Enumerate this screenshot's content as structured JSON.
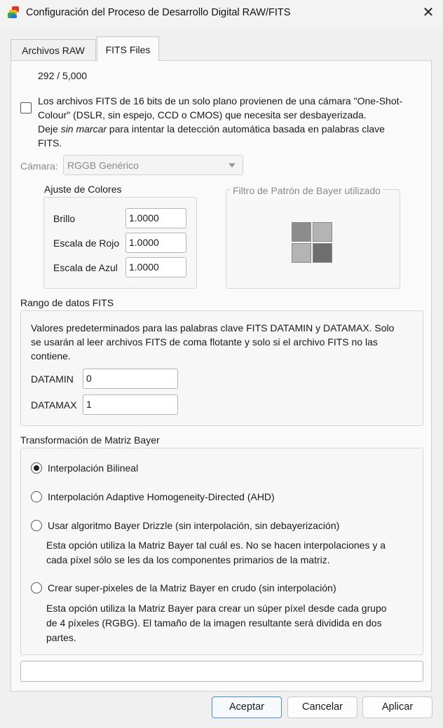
{
  "window": {
    "title": "Configuración del Proceso de Desarrollo Digital RAW/FITS",
    "close_glyph": "✕",
    "app_icon": "color-layers-icon"
  },
  "tabs": [
    {
      "label": "Archivos RAW",
      "active": false
    },
    {
      "label": "FITS Files",
      "active": true
    }
  ],
  "fits": {
    "counter": "292 / 5,000",
    "osc_checkbox_checked": false,
    "osc_desc_lines": [
      "Los archivos FITS de 16 bits de un solo plano provienen de una cámara \"One-Shot-",
      "Colour\" (DSLR, sin espejo, CCD o CMOS) que necesita ser desbayerizada."
    ],
    "hint_prefix": "Deje ",
    "hint_em": "sin marcar",
    "hint_suffix": " para intentar la detección automática basada en palabras clave",
    "hint_line2": "FITS.",
    "camera_label": "Cámara:",
    "camera_value": "RGGB Genérico",
    "color_group_title": "Ajuste de Colores",
    "brightness_label": "Brillo",
    "brightness_value": "1.0000",
    "red_label": "Escala de Rojo",
    "red_value": "1.0000",
    "blue_label": "Escala de Azul",
    "blue_value": "1.0000",
    "bayer_group_title": "Filtro de Patrón de Bayer utilizado",
    "bayer_colors": [
      "#8c8c8c",
      "#b4b4b4",
      "#b4b4b4",
      "#6e6e6e"
    ],
    "range_title": "Rango de datos FITS",
    "range_desc_lines": [
      "Valores predeterminados para las palabras clave FITS DATAMIN y DATAMAX. Solo",
      "se usarán al leer archivos FITS de coma flotante y solo si el archivo FITS no las",
      "contiene."
    ],
    "datamin_label": "DATAMIN",
    "datamin_value": "0",
    "datamax_label": "DATAMAX",
    "datamax_value": "1",
    "matrix_title": "Transformación de Matriz Bayer",
    "options": [
      {
        "label": "Interpolación Bilineal",
        "checked": true,
        "desc": []
      },
      {
        "label": "Interpolación Adaptive Homogeneity-Directed (AHD)",
        "checked": false,
        "desc": []
      },
      {
        "label": "Usar algoritmo Bayer Drizzle (sin interpolación, sin debayerización)",
        "checked": false,
        "desc": [
          "Esta opción utiliza la Matriz Bayer tal cuál es. No se hacen interpolaciones y a",
          "cada píxel sólo se les da los componentes primarios de la matriz."
        ]
      },
      {
        "label": "Crear super-pixeles de la Matriz Bayer en crudo (sin interpolación)",
        "checked": false,
        "desc": [
          "Esta opción utiliza la Matriz Bayer para crear un súper píxel desde cada grupo",
          "de 4 píxeles (RGBG). El tamaño de la imagen resultante será dividida en dos",
          "partes."
        ]
      }
    ],
    "status_value": ""
  },
  "buttons": {
    "ok": "Aceptar",
    "cancel": "Cancelar",
    "apply": "Aplicar"
  },
  "colors": {
    "accent": "#2a6fc0",
    "disabled_text": "#8a8a8a"
  }
}
